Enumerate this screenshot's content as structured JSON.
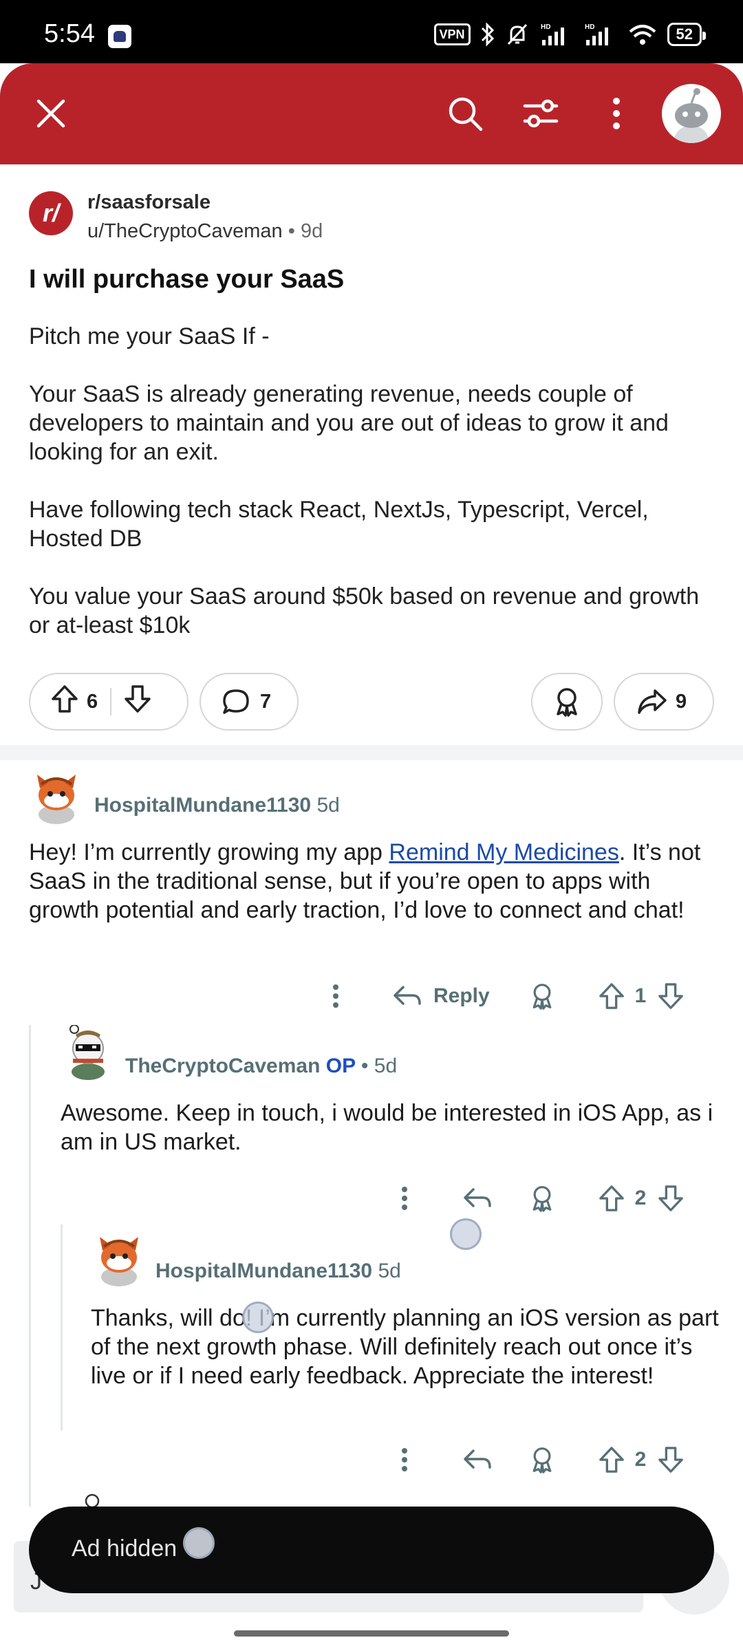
{
  "status_bar": {
    "time": "5:54",
    "vpn": "VPN",
    "battery": "52"
  },
  "header": {
    "close_icon": "close-icon",
    "search_icon": "search-icon",
    "filter_icon": "filter-icon",
    "more_icon": "more-vertical-icon",
    "accent_color": "#b8232a"
  },
  "post": {
    "subreddit": "r/saasforsale",
    "author": "u/TheCryptoCaveman",
    "dot": "•",
    "age": "9d",
    "title": "I will purchase your SaaS",
    "body": [
      "Pitch me your SaaS If -",
      "Your SaaS is already generating revenue, needs couple of developers to maintain and you are out of ideas to grow it and looking for an exit.",
      "Have following tech stack React, NextJs, Typescript, Vercel, Hosted DB",
      "You value your SaaS around $50k based on revenue and growth or at-least $10k"
    ],
    "upvotes": "6",
    "comments": "7",
    "shares": "9"
  },
  "comments": [
    {
      "user": "HospitalMundane1130",
      "age": "5d",
      "text_before_link": "Hey! I’m currently growing my app ",
      "link_text": "Remind My Medicines",
      "text_after_link": ". It’s not SaaS in the traditional sense, but if you’re open to apps with growth potential and early traction, I’d love to connect and chat!",
      "reply_label": "Reply",
      "votes": "1"
    },
    {
      "user": "TheCryptoCaveman",
      "op_label": "OP",
      "dot": "•",
      "age": "5d",
      "text": "Awesome. Keep in touch, i would be interested in iOS App, as i am in US market.",
      "votes": "2"
    },
    {
      "user": "HospitalMundane1130",
      "age": "5d",
      "text": "Thanks, will do! I’m currently planning an iOS version as part of the next growth phase. Will definitely reach out once it’s live or if I need early feedback. Appreciate the interest!",
      "votes": "2"
    }
  ],
  "toast": {
    "text": "Ad hidden"
  },
  "comment_bar_peek": "J"
}
